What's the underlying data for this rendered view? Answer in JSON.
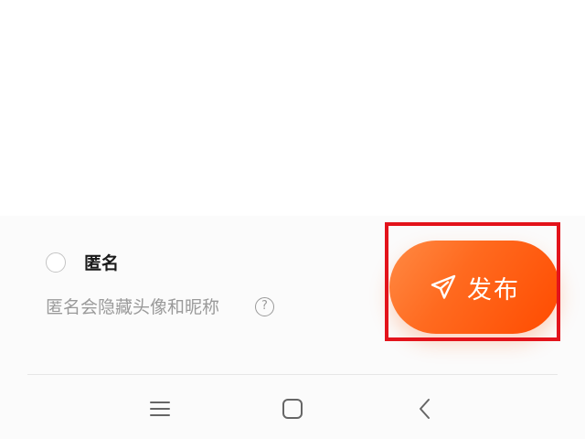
{
  "anonymous": {
    "label": "匿名",
    "hint": "匿名会隐藏头像和昵称",
    "help_icon": "?",
    "checked": false
  },
  "publish": {
    "label": "发布",
    "icon": "paper-plane-icon",
    "color": "#ff5a10",
    "highlight_color": "#e3131b"
  },
  "nav_bar": {
    "items": [
      "menu-icon",
      "home-icon",
      "back-icon"
    ]
  }
}
